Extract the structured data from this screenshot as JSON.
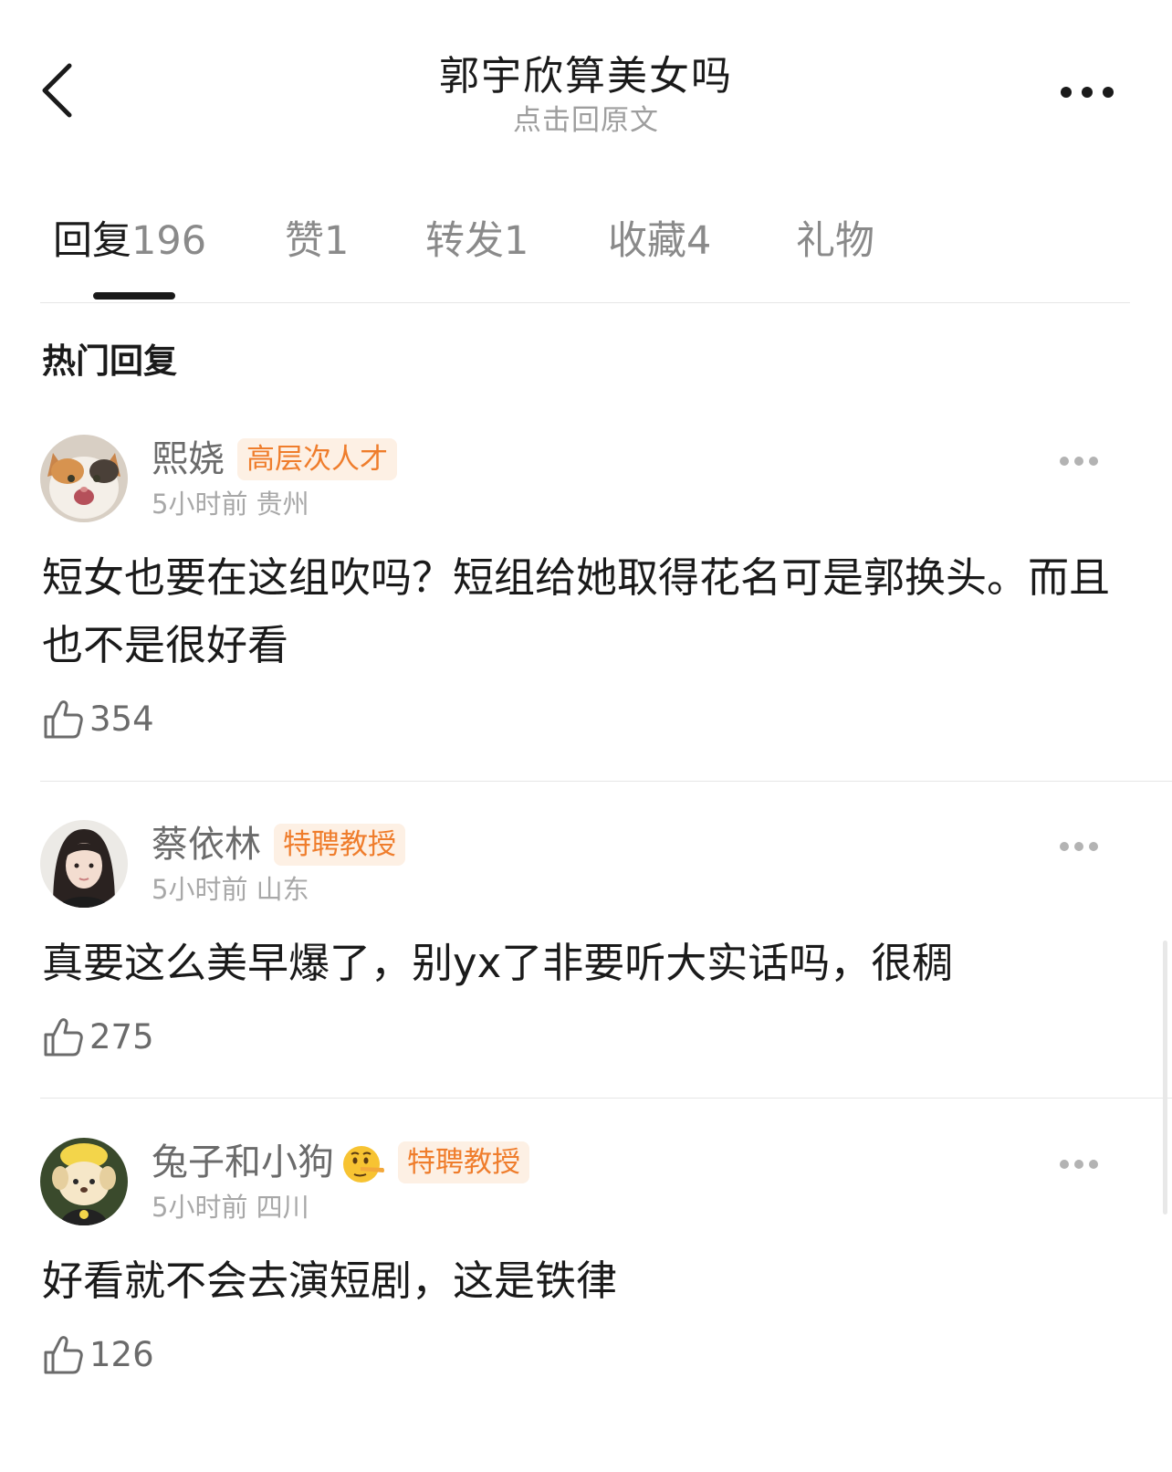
{
  "header": {
    "title": "郭宇欣算美女吗",
    "subtitle": "点击回原文"
  },
  "tabs": [
    {
      "label": "回复",
      "count": "196"
    },
    {
      "label": "赞",
      "count": "1"
    },
    {
      "label": "转发",
      "count": "1"
    },
    {
      "label": "收藏",
      "count": "4"
    },
    {
      "label": "礼物",
      "count": ""
    }
  ],
  "section_title": "热门回复",
  "comments": [
    {
      "username": "熙娆",
      "badge": "高层次人才",
      "time": "5小时前",
      "location": "贵州",
      "content": "短女也要在这组吹吗？短组给她取得花名可是郭换头。而且也不是很好看",
      "likes": "354",
      "avatar_icon": "cat-avatar"
    },
    {
      "username": "蔡依林",
      "badge": "特聘教授",
      "time": "5小时前",
      "location": "山东",
      "content": "真要这么美早爆了，别yx了非要听大实话吗，很稠",
      "likes": "275",
      "avatar_icon": "girl-avatar"
    },
    {
      "username": "兔子和小狗",
      "badge": "特聘教授",
      "time": "5小时前",
      "location": "四川",
      "content": "好看就不会去演短剧，这是铁律",
      "likes": "126",
      "avatar_icon": "plush-dog-avatar",
      "emoji": "lying-face-emoji"
    }
  ],
  "colors": {
    "badge_text": "#ef7d2c",
    "badge_bg": "#fdf0e4",
    "muted": "#a8a8a8"
  }
}
